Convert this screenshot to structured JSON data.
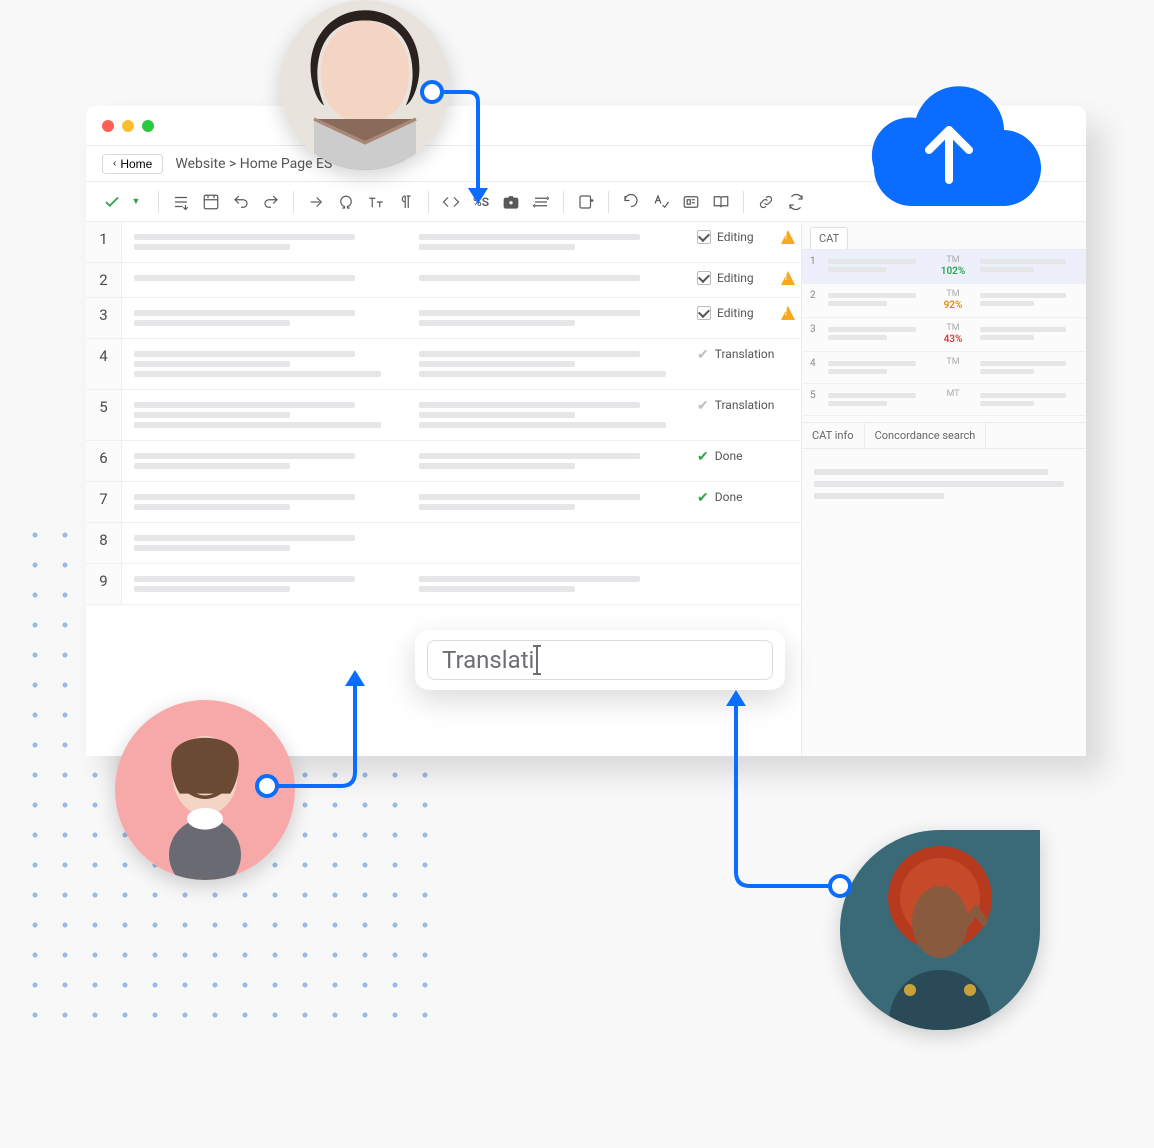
{
  "nav": {
    "home_label": "Home",
    "breadcrumb": "Website > Home Page ES"
  },
  "toolbar_icons": [
    "confirm-check",
    "dropdown",
    "sep",
    "segment-down",
    "screenshot",
    "undo",
    "redo",
    "sep",
    "goto",
    "omega",
    "text-size",
    "pilcrow",
    "sep",
    "code",
    "percent-s",
    "camera",
    "lines",
    "sep",
    "book-plus",
    "sep",
    "revert",
    "spellcheck",
    "preview",
    "book-open",
    "sep",
    "link",
    "sync"
  ],
  "segments": [
    {
      "n": 1,
      "status": "Editing",
      "checked": true,
      "warn": true,
      "src": 2,
      "tgt": 2
    },
    {
      "n": 2,
      "status": "Editing",
      "checked": true,
      "warn": true,
      "src": 1,
      "tgt": 1
    },
    {
      "n": 3,
      "status": "Editing",
      "checked": true,
      "warn": true,
      "src": 2,
      "tgt": 2
    },
    {
      "n": 4,
      "status": "Translation",
      "checked": false,
      "warn": false,
      "src": 3,
      "tgt": 3
    },
    {
      "n": 5,
      "status": "Translation",
      "checked": false,
      "warn": false,
      "src": 3,
      "tgt": 3
    },
    {
      "n": 6,
      "status": "Done",
      "checked": false,
      "warn": false,
      "src": 2,
      "tgt": 2
    },
    {
      "n": 7,
      "status": "Done",
      "checked": false,
      "warn": false,
      "src": 2,
      "tgt": 2
    },
    {
      "n": 8,
      "status": "",
      "checked": false,
      "warn": false,
      "src": 2,
      "tgt": 0
    },
    {
      "n": 9,
      "status": "",
      "checked": false,
      "warn": false,
      "src": 2,
      "tgt": 2
    }
  ],
  "cat": {
    "tab_label": "CAT",
    "matches": [
      {
        "n": 1,
        "src_label": "TM",
        "pct": "102%",
        "pct_class": "g",
        "highlight": true
      },
      {
        "n": 2,
        "src_label": "TM",
        "pct": "92%",
        "pct_class": "o",
        "highlight": false
      },
      {
        "n": 3,
        "src_label": "TM",
        "pct": "43%",
        "pct_class": "r",
        "highlight": false
      },
      {
        "n": 4,
        "src_label": "TM",
        "pct": "",
        "pct_class": "n",
        "highlight": false
      },
      {
        "n": 5,
        "src_label": "MT",
        "pct": "",
        "pct_class": "n",
        "highlight": false
      }
    ],
    "info_tabs": [
      "CAT info",
      "Concordance search"
    ]
  },
  "search": {
    "typed": "Translati"
  }
}
